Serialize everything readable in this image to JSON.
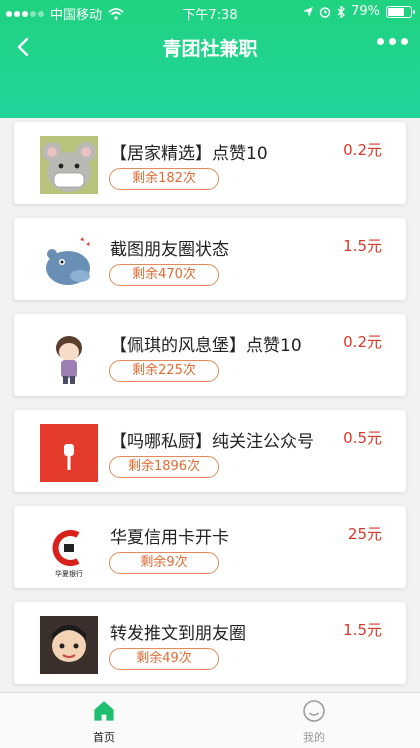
{
  "status_bar": {
    "carrier": "中国移动",
    "time": "下午7:38",
    "battery": "79%",
    "battery_level": 0.79
  },
  "navbar": {
    "title": "青团社兼职",
    "back_icon": "chevron-left-icon",
    "more_icon": "more-dots-icon"
  },
  "tasks": [
    {
      "title": "【居家精选】点赞10",
      "price": "0.2元",
      "remaining": "剩余182次",
      "thumb": "mouse-mask-avatar"
    },
    {
      "title": "截图朋友圈状态",
      "price": "1.5元",
      "remaining": "剩余470次",
      "thumb": "hippo-avatar"
    },
    {
      "title": "【佩琪的风息堡】点赞10",
      "price": "0.2元",
      "remaining": "剩余225次",
      "thumb": "cartoon-boy-avatar"
    },
    {
      "title": "【吗哪私厨】纯关注公众号",
      "price": "0.5元",
      "remaining": "剩余1896次",
      "thumb": "red-logo-avatar"
    },
    {
      "title": "华夏信用卡开卡",
      "price": "25元",
      "remaining": "剩余9次",
      "thumb": "huaxia-bank-logo",
      "thumb_text": "华夏银行"
    },
    {
      "title": "转发推文到朋友圈",
      "price": "1.5元",
      "remaining": "剩余49次",
      "thumb": "cartoon-character-avatar"
    }
  ],
  "tabbar": {
    "home_label": "首页",
    "mine_label": "我的",
    "active": "home"
  },
  "colors": {
    "header": "#1fd37f",
    "price": "#d9382b",
    "badge_border": "#e38a5a",
    "tab_active": "#1fbf6f"
  }
}
